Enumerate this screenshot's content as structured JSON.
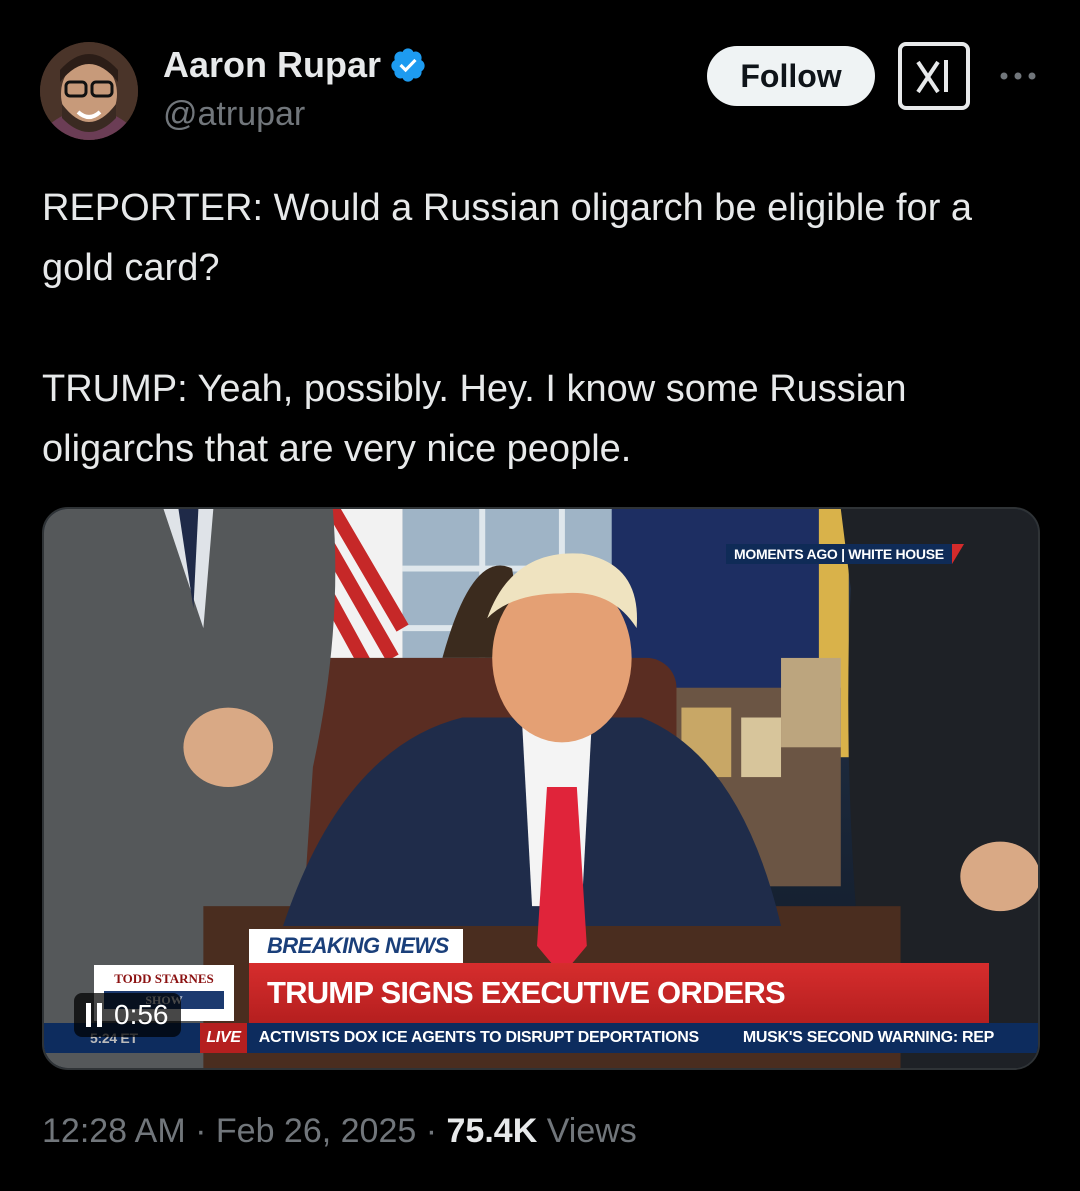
{
  "author": {
    "name": "Aaron Rupar",
    "handle": "@atrupar",
    "verified": true
  },
  "actions": {
    "follow_label": "Follow",
    "grok_icon": "grok-icon",
    "more_icon": "more-icon"
  },
  "tweet": {
    "paragraphs": [
      "REPORTER: Would a Russian oligarch be eligible for a gold card?",
      "TRUMP: Yeah, possibly. Hey. I know some Russian oligarchs that are very nice people."
    ]
  },
  "video": {
    "tag": "MOMENTS AGO | WHITE HOUSE",
    "breaking": "BREAKING NEWS",
    "headline": "TRUMP SIGNS EXECUTIVE ORDERS",
    "show_top": "TODD STARNES",
    "show_bottom": "SHOW",
    "ticker_time": "5:24 ET",
    "ticker_live": "LIVE",
    "ticker_items": [
      "ACTIVISTS DOX ICE AGENTS TO DISRUPT DEPORTATIONS",
      "MUSK'S SECOND WARNING: REP"
    ],
    "duration": "0:56",
    "state": "playing"
  },
  "meta": {
    "time": "12:28 AM",
    "separator": "·",
    "date": "Feb 26, 2025",
    "views_count": "75.4K",
    "views_label": "Views"
  },
  "colors": {
    "background": "#000000",
    "text": "#e7e9ea",
    "secondary": "#71767b",
    "verified_blue": "#1d9bf0"
  }
}
